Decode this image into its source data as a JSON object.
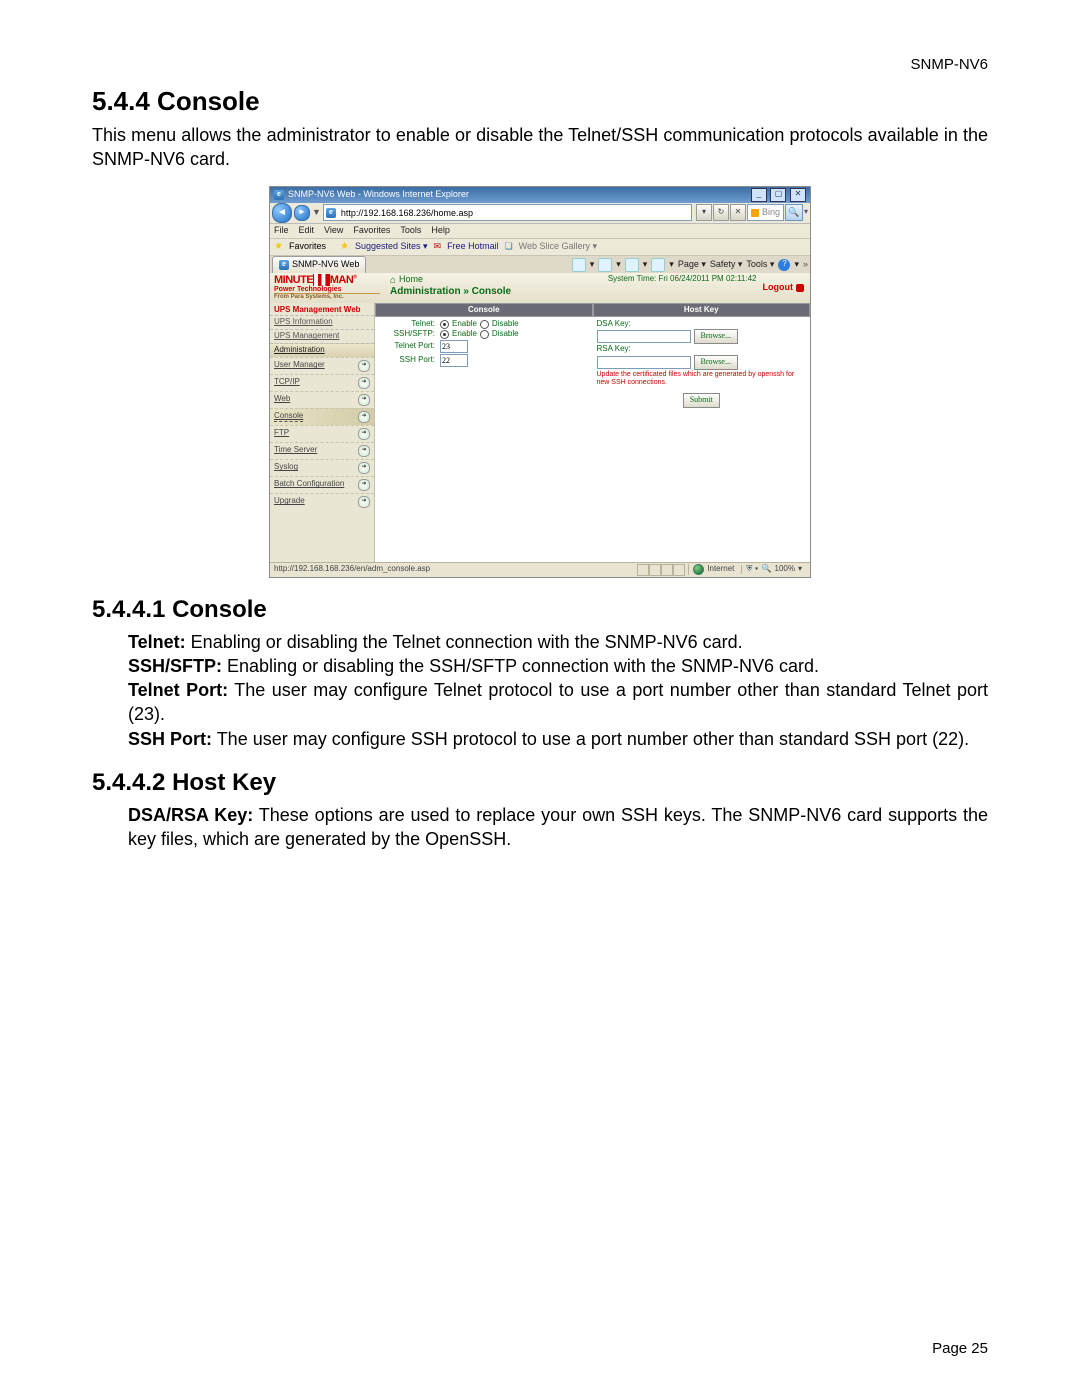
{
  "header_right": "SNMP-NV6",
  "footer_page_label": "Page 25",
  "sec_544_title": "5.4.4 Console",
  "sec_544_intro": "This menu allows the administrator to enable or disable the Telnet/SSH communication protocols available in the SNMP-NV6 card.",
  "sec_5441_title": "5.4.4.1 Console",
  "defs_5441": {
    "telnet_b": "Telnet:",
    "telnet_t": " Enabling or disabling the Telnet connection with the SNMP-NV6 card.",
    "ssh_b": "SSH/SFTP:",
    "ssh_t": " Enabling or disabling the SSH/SFTP connection with the SNMP-NV6 card.",
    "tport_b": "Telnet Port:",
    "tport_t": " The user may configure Telnet protocol to use a port number other than standard Telnet port (23).",
    "sport_b": "SSH Port:",
    "sport_t": " The user may configure SSH protocol to use a port number other than standard SSH port (22)."
  },
  "sec_5442_title": "5.4.4.2 Host Key",
  "defs_5442": {
    "dsa_b": "DSA/RSA Key:",
    "dsa_t": " These options are used to replace your own SSH keys. The SNMP-NV6 card supports the key files, which are generated by the OpenSSH."
  },
  "shot": {
    "window_title": "SNMP-NV6 Web - Windows Internet Explorer",
    "address_url": "http://192.168.168.236/home.asp",
    "search_engine": "Bing",
    "menu": {
      "file": "File",
      "edit": "Edit",
      "view": "View",
      "favorites": "Favorites",
      "tools": "Tools",
      "help": "Help"
    },
    "favbar": {
      "label": "Favorites",
      "item1": "Suggested Sites ▾",
      "item2": "Free Hotmail",
      "item3": "Web Slice Gallery ▾"
    },
    "tab_title": "SNMP-NV6 Web",
    "cmdbar": {
      "page": "Page ▾",
      "safety": "Safety ▾",
      "tools": "Tools ▾"
    },
    "brand": {
      "line1a": "MINUTE",
      "line1b": "MAN",
      "line2": "Power Technologies",
      "line3": "From Para Systems, Inc."
    },
    "breadcrumb_home": "Home",
    "breadcrumb_path": "Administration » Console",
    "system_time": "System Time: Fri 06/24/2011 PM 02:11:42",
    "logout": "Logout",
    "sidebar": {
      "title": "UPS Management Web",
      "groups": {
        "info": "UPS Information",
        "mgmt": "UPS Management",
        "admin": "Administration"
      },
      "items": [
        {
          "label": "User Manager"
        },
        {
          "label": "TCP/IP"
        },
        {
          "label": "Web"
        },
        {
          "label": "Console",
          "selected": true
        },
        {
          "label": "FTP"
        },
        {
          "label": "Time Server"
        },
        {
          "label": "Syslog"
        },
        {
          "label": "Batch Configuration"
        },
        {
          "label": "Upgrade"
        }
      ]
    },
    "panel_console": {
      "title": "Console",
      "rows": {
        "telnet_label": "Telnet:",
        "ssh_label": "SSH/SFTP:",
        "enable": "Enable",
        "disable": "Disable",
        "telnet_port_label": "Telnet Port:",
        "telnet_port_value": "23",
        "ssh_port_label": "SSH Port:",
        "ssh_port_value": "22"
      }
    },
    "panel_hostkey": {
      "title": "Host Key",
      "dsa_label": "DSA Key:",
      "rsa_label": "RSA Key:",
      "browse": "Browse...",
      "note": "Update the certificated files which are generated by openssh for new SSH connections."
    },
    "submit": "Submit",
    "status_url": "http://192.168.168.236/en/adm_console.asp",
    "status_zone": "Internet",
    "status_zoom": "100%"
  }
}
